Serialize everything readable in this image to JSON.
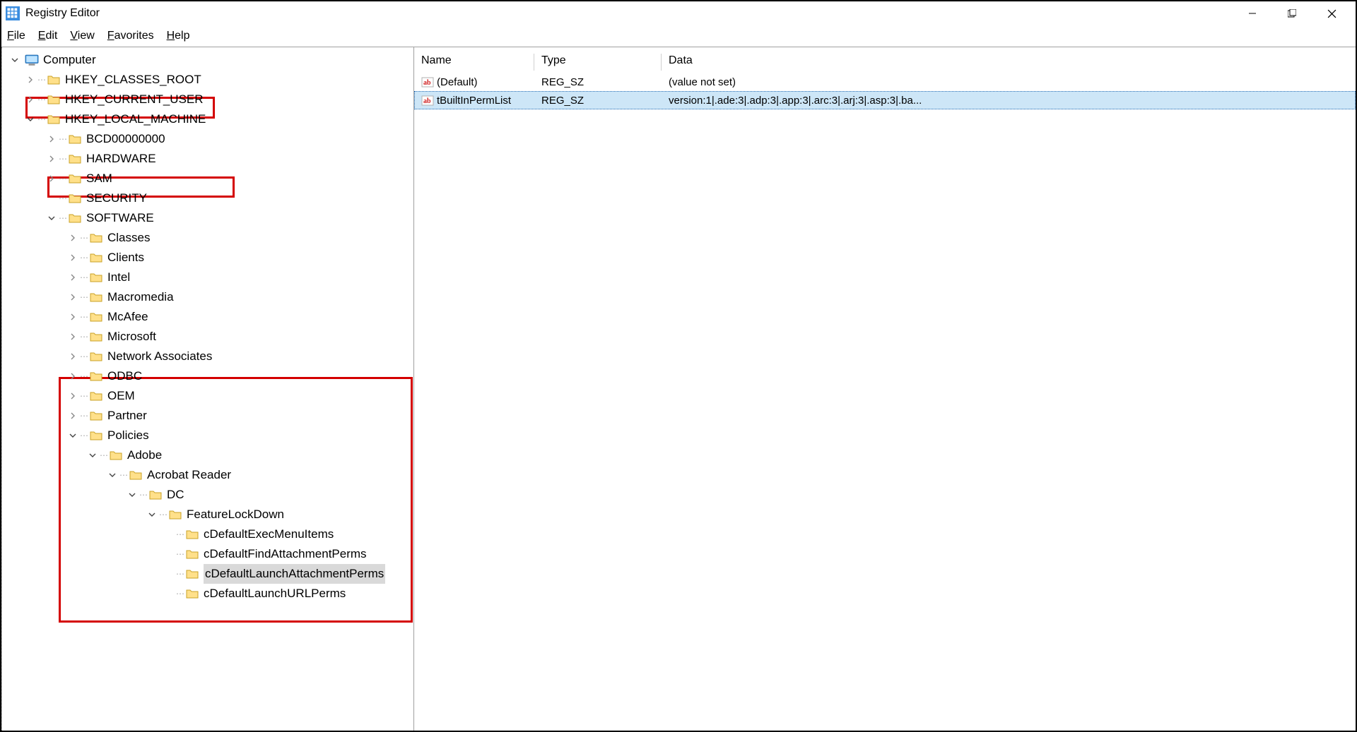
{
  "title": "Registry Editor",
  "menu": {
    "file": "File",
    "edit": "Edit",
    "view": "View",
    "favorites": "Favorites",
    "help": "Help"
  },
  "tree": {
    "root": "Computer",
    "hkcr": "HKEY_CLASSES_ROOT",
    "hkcu": "HKEY_CURRENT_USER",
    "hklm": "HKEY_LOCAL_MACHINE",
    "bcd": "BCD00000000",
    "hw": "HARDWARE",
    "sam": "SAM",
    "sec": "SECURITY",
    "sw": "SOFTWARE",
    "classes": "Classes",
    "clients": "Clients",
    "intel": "Intel",
    "macromedia": "Macromedia",
    "mcafee": "McAfee",
    "microsoft": "Microsoft",
    "netassoc": "Network Associates",
    "odbc": "ODBC",
    "oem": "OEM",
    "partner": "Partner",
    "policies": "Policies",
    "adobe": "Adobe",
    "ar": "Acrobat Reader",
    "dc": "DC",
    "fld": "FeatureLockDown",
    "c1": "cDefaultExecMenuItems",
    "c2": "cDefaultFindAttachmentPerms",
    "c3": "cDefaultLaunchAttachmentPerms",
    "c4": "cDefaultLaunchURLPerms"
  },
  "columns": {
    "name": "Name",
    "type": "Type",
    "data": "Data"
  },
  "values": [
    {
      "name": "(Default)",
      "type": "REG_SZ",
      "data": "(value not set)",
      "selected": false
    },
    {
      "name": "tBuiltInPermList",
      "type": "REG_SZ",
      "data": "version:1|.ade:3|.adp:3|.app:3|.arc:3|.arj:3|.asp:3|.ba...",
      "selected": true
    }
  ]
}
